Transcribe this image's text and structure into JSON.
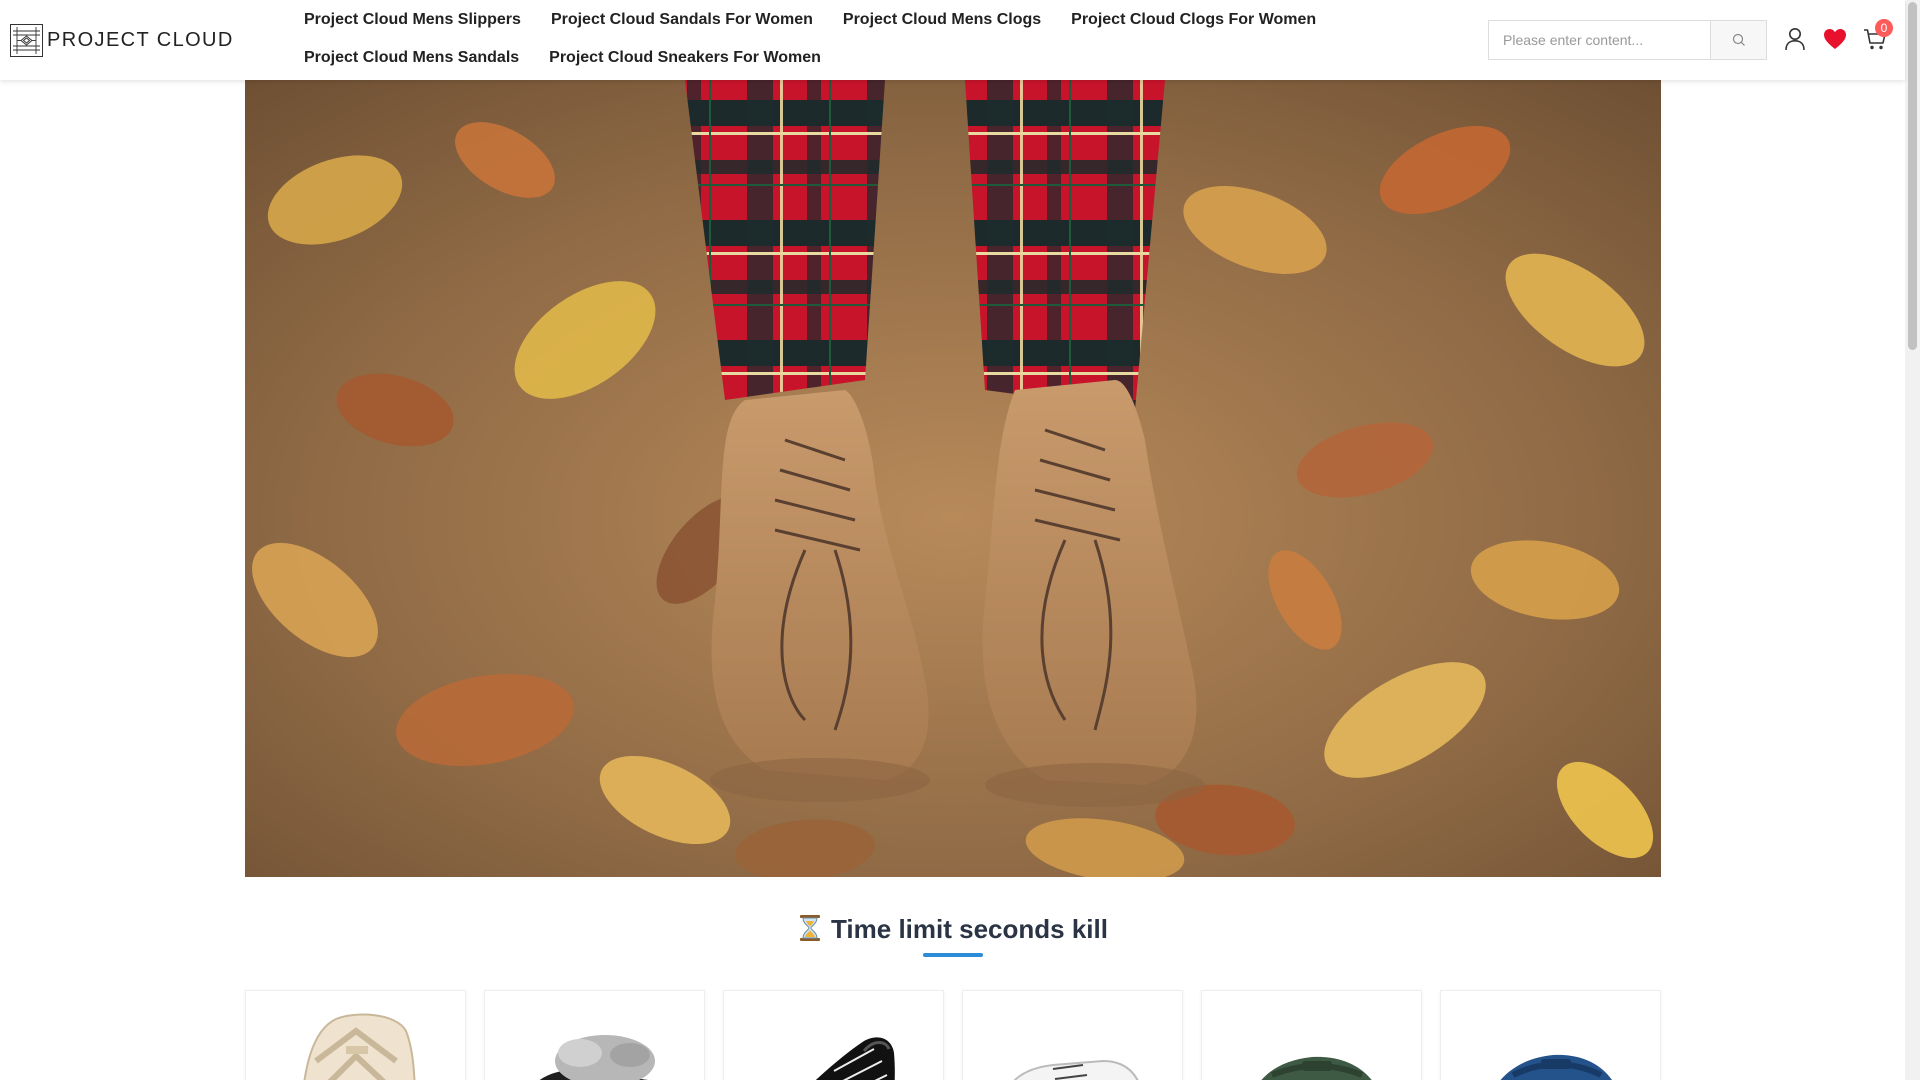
{
  "brand": {
    "name": "PROJECT CLOUD"
  },
  "nav": {
    "items": [
      {
        "label": "Project Cloud Mens Slippers"
      },
      {
        "label": "Project Cloud Sandals For Women"
      },
      {
        "label": "Project Cloud Mens Clogs"
      },
      {
        "label": "Project Cloud Clogs For Women"
      },
      {
        "label": "Project Cloud Mens Sandals"
      },
      {
        "label": "Project Cloud Sneakers For Women"
      }
    ]
  },
  "search": {
    "placeholder": "Please enter content...",
    "value": ""
  },
  "header_icons": {
    "account": "user-icon",
    "wishlist": "heart-icon",
    "cart": "cart-icon"
  },
  "cart": {
    "count": "0"
  },
  "colors": {
    "accent": "#2d8cd8",
    "heart": "#e8112d",
    "badge": "#ff5a5a",
    "title": "#2b3445"
  },
  "hero": {
    "image": "boots-on-autumn-leaves"
  },
  "flash_sale": {
    "title": "Time limit seconds kill",
    "icon": "hourglass-icon",
    "products": [
      {
        "image": "beige-sandal"
      },
      {
        "image": "grey-fur-slipper"
      },
      {
        "image": "black-sneaker"
      },
      {
        "image": "white-sneaker"
      },
      {
        "image": "green-clog"
      },
      {
        "image": "blue-clog"
      }
    ]
  }
}
